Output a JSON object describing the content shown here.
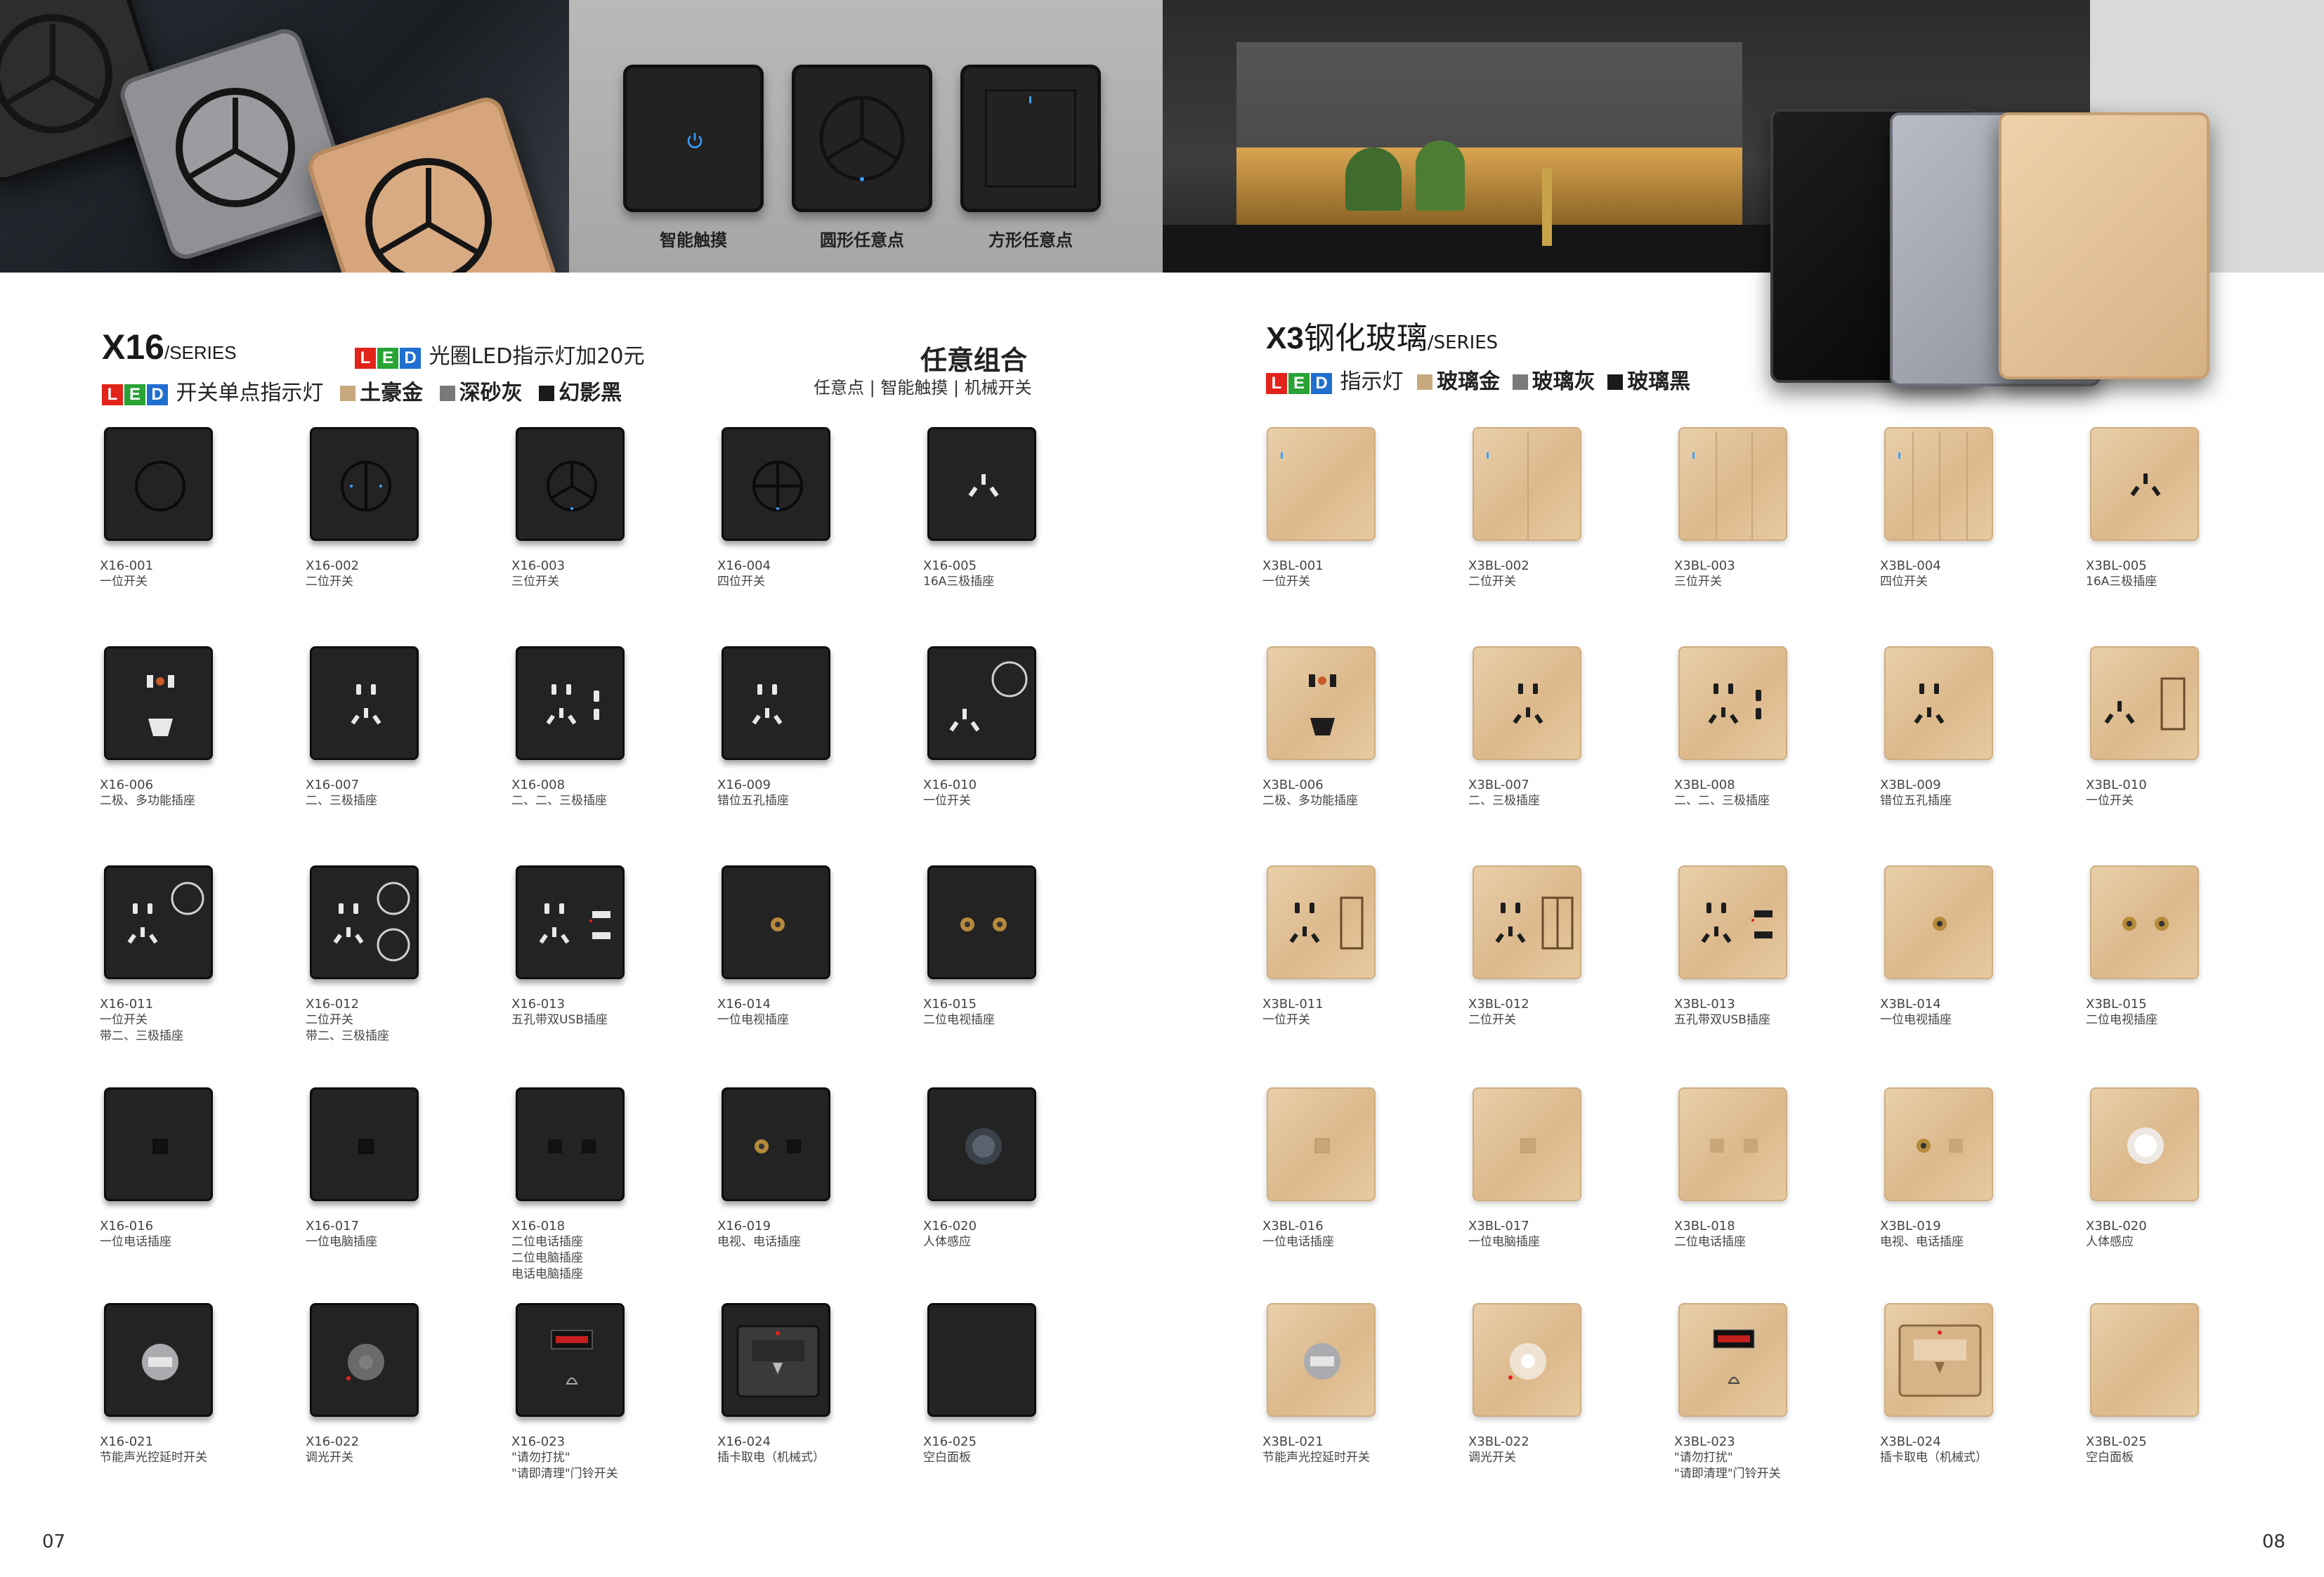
{
  "banner": {
    "demo_items": [
      {
        "label": "智能触摸",
        "icon": "power-icon"
      },
      {
        "label": "圆形任意点",
        "icon": "tri-circle-icon"
      },
      {
        "label": "方形任意点",
        "icon": "square-switch-icon"
      }
    ]
  },
  "left": {
    "series_code": "X16",
    "series_suffix": "/SERIES",
    "led_letters": [
      "L",
      "E",
      "D"
    ],
    "feature_line1": "光圈LED指示灯加20元",
    "feature_line2": "开关单点指示灯",
    "colors": [
      {
        "name": "土豪金",
        "hex": "#c8a97e"
      },
      {
        "name": "深砂灰",
        "hex": "#7a7a7a"
      },
      {
        "name": "幻影黑",
        "hex": "#1a1a1a"
      }
    ],
    "combo_title": "任意组合",
    "combo_subtitle": "任意点 | 智能触摸 | 机械开关",
    "page_number": "07",
    "products": [
      {
        "code": "X16-001",
        "desc": "一位开关",
        "icon": "ring-1-icon"
      },
      {
        "code": "X16-002",
        "desc": "二位开关",
        "icon": "ring-2-icon"
      },
      {
        "code": "X16-003",
        "desc": "三位开关",
        "icon": "ring-3-icon"
      },
      {
        "code": "X16-004",
        "desc": "四位开关",
        "icon": "ring-4-icon"
      },
      {
        "code": "X16-005",
        "desc": "16A三极插座",
        "icon": "socket-3pin-icon"
      },
      {
        "code": "X16-006",
        "desc": "二极、多功能插座",
        "icon": "socket-multi-icon"
      },
      {
        "code": "X16-007",
        "desc": "二、三极插座",
        "icon": "socket-5pin-icon"
      },
      {
        "code": "X16-008",
        "desc": "二、二、三极插座",
        "icon": "socket-7pin-icon"
      },
      {
        "code": "X16-009",
        "desc": "错位五孔插座",
        "icon": "socket-5pin-offset-icon"
      },
      {
        "code": "X16-010",
        "desc": "一位开关",
        "icon": "socket-switch-icon"
      },
      {
        "code": "X16-011",
        "desc": "一位开关\n带二、三极插座",
        "icon": "socket-5pin-switch-icon"
      },
      {
        "code": "X16-012",
        "desc": "二位开关\n带二、三极插座",
        "icon": "socket-5pin-2switch-icon"
      },
      {
        "code": "X16-013",
        "desc": "五孔带双USB插座",
        "icon": "socket-usb-icon"
      },
      {
        "code": "X16-014",
        "desc": "一位电视插座",
        "icon": "tv-1-icon"
      },
      {
        "code": "X16-015",
        "desc": "二位电视插座",
        "icon": "tv-2-icon"
      },
      {
        "code": "X16-016",
        "desc": "一位电话插座",
        "icon": "data-1-icon"
      },
      {
        "code": "X16-017",
        "desc": "一位电脑插座",
        "icon": "data-1-icon"
      },
      {
        "code": "X16-018",
        "desc": "二位电话插座\n二位电脑插座\n电话电脑插座",
        "icon": "data-2-icon"
      },
      {
        "code": "X16-019",
        "desc": "电视、电话插座",
        "icon": "tv-data-icon"
      },
      {
        "code": "X16-020",
        "desc": "人体感应",
        "icon": "sensor-icon"
      },
      {
        "code": "X16-021",
        "desc": "节能声光控延时开关",
        "icon": "sound-light-icon"
      },
      {
        "code": "X16-022",
        "desc": "调光开关",
        "icon": "dimmer-icon"
      },
      {
        "code": "X16-023",
        "desc": "\"请勿打扰\"\n\"请即清理\"门铃开关",
        "icon": "doorbell-icon"
      },
      {
        "code": "X16-024",
        "desc": "插卡取电（机械式）",
        "icon": "keycard-icon"
      },
      {
        "code": "X16-025",
        "desc": "空白面板",
        "icon": "blank-icon"
      }
    ]
  },
  "right": {
    "series_code": "X3",
    "series_name": "钢化玻璃",
    "series_suffix": "/SERIES",
    "led_letters": [
      "L",
      "E",
      "D"
    ],
    "feature_line": "指示灯",
    "colors": [
      {
        "name": "玻璃金",
        "hex": "#c8a97e"
      },
      {
        "name": "玻璃灰",
        "hex": "#7a7a7a"
      },
      {
        "name": "玻璃黑",
        "hex": "#1a1a1a"
      }
    ],
    "page_number": "08",
    "products": [
      {
        "code": "X3BL-001",
        "desc": "一位开关",
        "icon": "gang-1-icon"
      },
      {
        "code": "X3BL-002",
        "desc": "二位开关",
        "icon": "gang-2-icon"
      },
      {
        "code": "X3BL-003",
        "desc": "三位开关",
        "icon": "gang-3-icon"
      },
      {
        "code": "X3BL-004",
        "desc": "四位开关",
        "icon": "gang-4-icon"
      },
      {
        "code": "X3BL-005",
        "desc": "16A三极插座",
        "icon": "socket-3pin-icon"
      },
      {
        "code": "X3BL-006",
        "desc": "二极、多功能插座",
        "icon": "socket-multi-icon"
      },
      {
        "code": "X3BL-007",
        "desc": "二、三极插座",
        "icon": "socket-5pin-icon"
      },
      {
        "code": "X3BL-008",
        "desc": "二、二、三极插座",
        "icon": "socket-7pin-icon"
      },
      {
        "code": "X3BL-009",
        "desc": "错位五孔插座",
        "icon": "socket-5pin-offset-icon"
      },
      {
        "code": "X3BL-010",
        "desc": "一位开关",
        "icon": "socket-rect-switch-icon"
      },
      {
        "code": "X3BL-011",
        "desc": "一位开关",
        "icon": "socket-5pin-rect-icon"
      },
      {
        "code": "X3BL-012",
        "desc": "二位开关",
        "icon": "socket-5pin-2rect-icon"
      },
      {
        "code": "X3BL-013",
        "desc": "五孔带双USB插座",
        "icon": "socket-usb-icon"
      },
      {
        "code": "X3BL-014",
        "desc": "一位电视插座",
        "icon": "tv-1-icon"
      },
      {
        "code": "X3BL-015",
        "desc": "二位电视插座",
        "icon": "tv-2-icon"
      },
      {
        "code": "X3BL-016",
        "desc": "一位电话插座",
        "icon": "data-1-icon"
      },
      {
        "code": "X3BL-017",
        "desc": "一位电脑插座",
        "icon": "data-1-icon"
      },
      {
        "code": "X3BL-018",
        "desc": "二位电话插座",
        "icon": "data-2-icon"
      },
      {
        "code": "X3BL-019",
        "desc": "电视、电话插座",
        "icon": "tv-data-icon"
      },
      {
        "code": "X3BL-020",
        "desc": "人体感应",
        "icon": "sensor-icon"
      },
      {
        "code": "X3BL-021",
        "desc": "节能声光控延时开关",
        "icon": "sound-light-icon"
      },
      {
        "code": "X3BL-022",
        "desc": "调光开关",
        "icon": "dimmer-icon"
      },
      {
        "code": "X3BL-023",
        "desc": "\"请勿打扰\"\n\"请即清理\"门铃开关",
        "icon": "doorbell-icon"
      },
      {
        "code": "X3BL-024",
        "desc": "插卡取电（机械式）",
        "icon": "keycard-icon"
      },
      {
        "code": "X3BL-025",
        "desc": "空白面板",
        "icon": "blank-icon"
      }
    ]
  }
}
